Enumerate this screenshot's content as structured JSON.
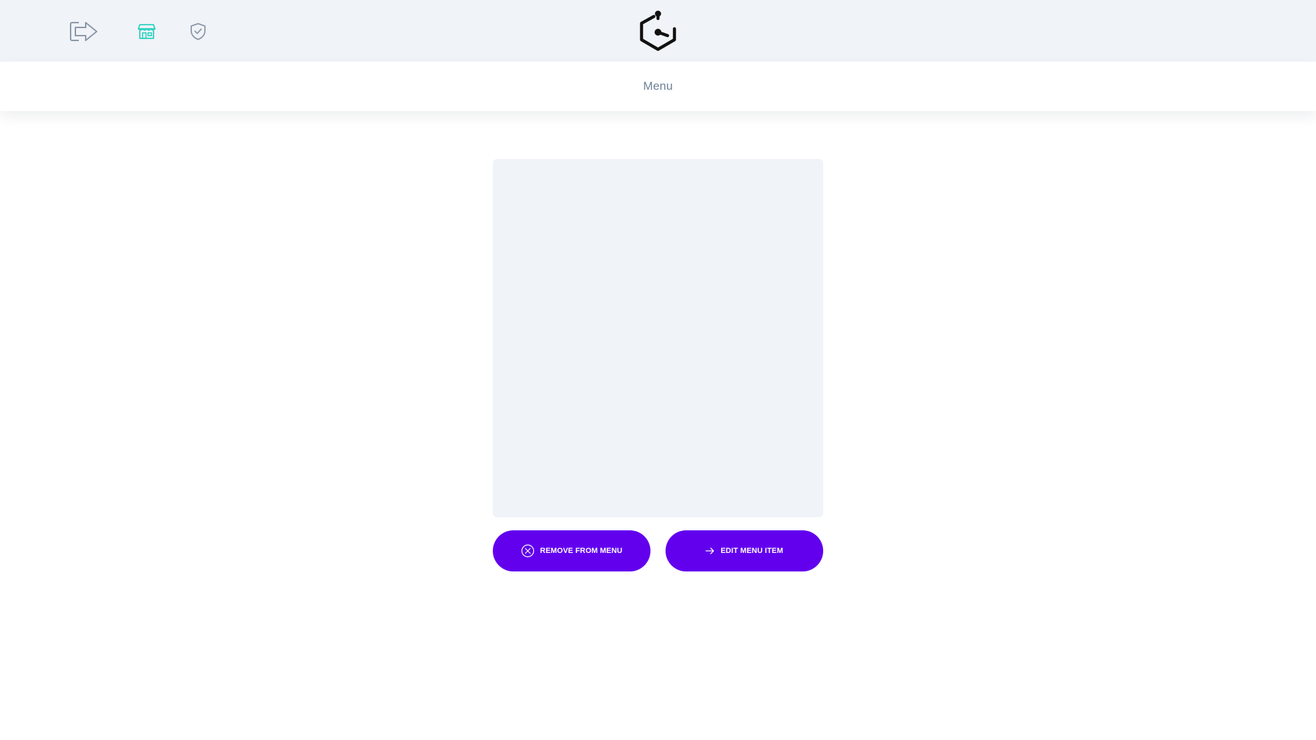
{
  "colors": {
    "topbar_bg": "#f0f3f7",
    "accent_teal": "#2ad1c0",
    "icon_gray": "#8a97a6",
    "primary": "#6200ee",
    "title_text": "#6b7f95"
  },
  "topbar": {
    "icons": [
      "logout-icon",
      "store-icon",
      "shield-check-icon"
    ],
    "logo_icon": "hexagon-logo-icon"
  },
  "subheader": {
    "title": "Menu"
  },
  "actions": {
    "remove_label": "REMOVE FROM MENU",
    "remove_icon": "circle-x-icon",
    "edit_label": "EDIT MENU ITEM",
    "edit_icon": "arrow-right-icon"
  }
}
